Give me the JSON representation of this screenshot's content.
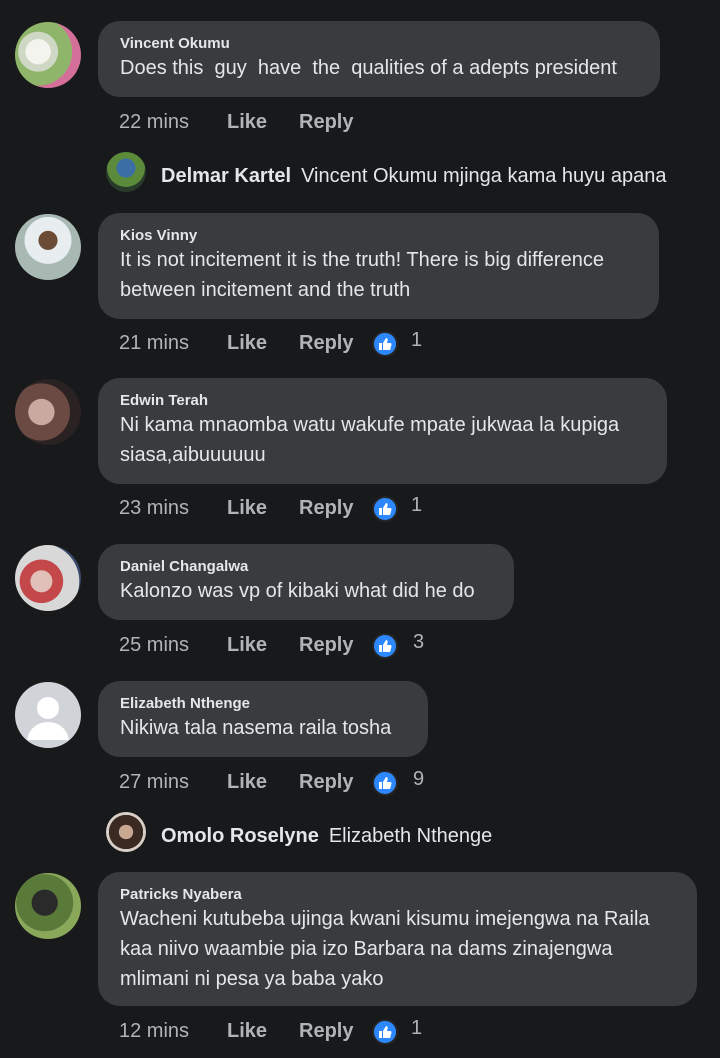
{
  "comments": [
    {
      "author": "Vincent Okumu",
      "text": "Does this  guy  have  the  qualities of a adepts president",
      "time": "22 mins",
      "like": "Like",
      "reply": "Reply",
      "reactions": ""
    },
    {
      "author": "Kios Vinny",
      "text": "It is not incitement it is the truth! There is big difference\nbetween incitement and the truth",
      "time": "21 mins",
      "like": "Like",
      "reply": "Reply",
      "reactions": "1"
    },
    {
      "author": "Edwin Terah",
      "text": "Ni kama mnaomba watu wakufe mpate jukwaa la kupiga\nsiasa,aibuuuuuu",
      "time": "23 mins",
      "like": "Like",
      "reply": "Reply",
      "reactions": "1"
    },
    {
      "author": "Daniel Changalwa",
      "text": "Kalonzo was vp of kibaki what did he do",
      "time": "25 mins",
      "like": "Like",
      "reply": "Reply",
      "reactions": "3"
    },
    {
      "author": "Elizabeth Nthenge",
      "text": "Nikiwa tala nasema raila tosha",
      "time": "27 mins",
      "like": "Like",
      "reply": "Reply",
      "reactions": "9"
    },
    {
      "author": "Patricks Nyabera",
      "text": "Wacheni kutubeba ujinga kwani kisumu imejengwa na Raila\nkaa niivo waambie pia izo Barbara na dams zinajengwa\nmlimani ni pesa ya baba yako",
      "time": "12 mins",
      "like": "Like",
      "reply": "Reply",
      "reactions": "1"
    }
  ],
  "replies": [
    {
      "author": "Delmar Kartel",
      "text": "Vincent Okumu mjinga kama huyu apana"
    },
    {
      "author": "Omolo Roselyne",
      "text": "Elizabeth Nthenge"
    }
  ],
  "colors": {
    "background": "#18191a",
    "bubble": "#3a3b3c",
    "accent": "#2d88ff",
    "muted": "#b0b3b8"
  }
}
